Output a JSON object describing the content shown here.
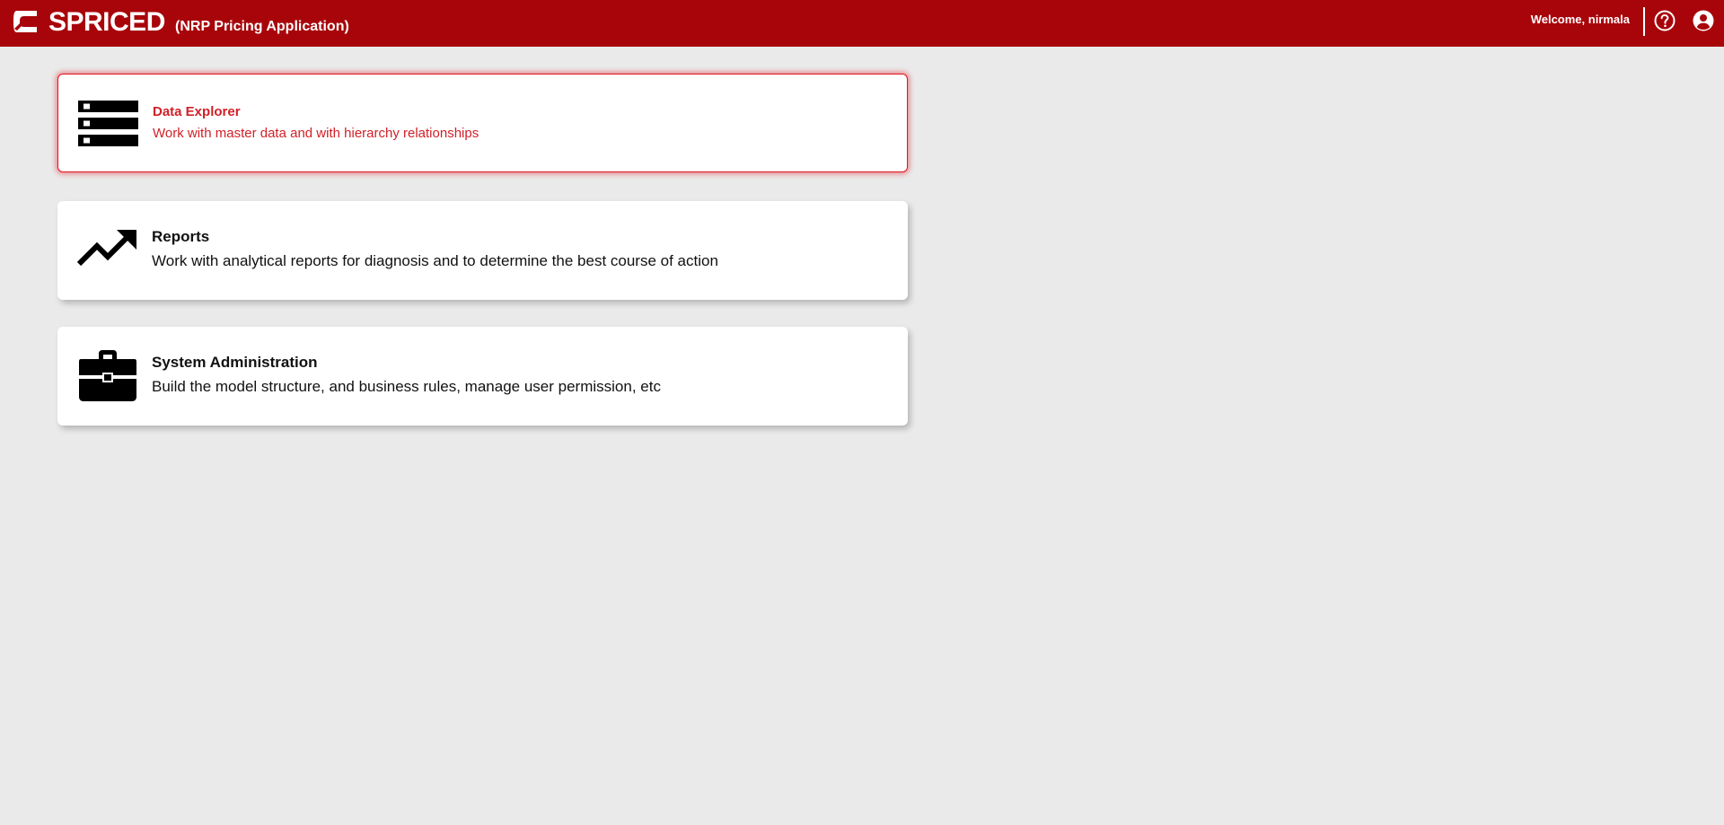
{
  "header": {
    "app_name": "SPRICED",
    "app_subtitle": "(NRP Pricing Application)",
    "welcome_text": "Welcome, nirmala",
    "help_icon": "help-circle-icon",
    "user_icon": "account-circle-icon",
    "brand_color": "#a8050a"
  },
  "modules": [
    {
      "title": "Data Explorer",
      "description": "Work with master data and with hierarchy relationships",
      "icon": "server-stack-icon",
      "active": true
    },
    {
      "title": "Reports",
      "description": "Work with analytical reports for diagnosis and to determine the best course of action",
      "icon": "trending-up-icon",
      "active": false
    },
    {
      "title": "System Administration",
      "description": "Build the model structure, and business rules, manage user permission, etc",
      "icon": "briefcase-icon",
      "active": false
    }
  ],
  "colors": {
    "active_accent": "#e2141e",
    "background": "#eaeaea"
  }
}
